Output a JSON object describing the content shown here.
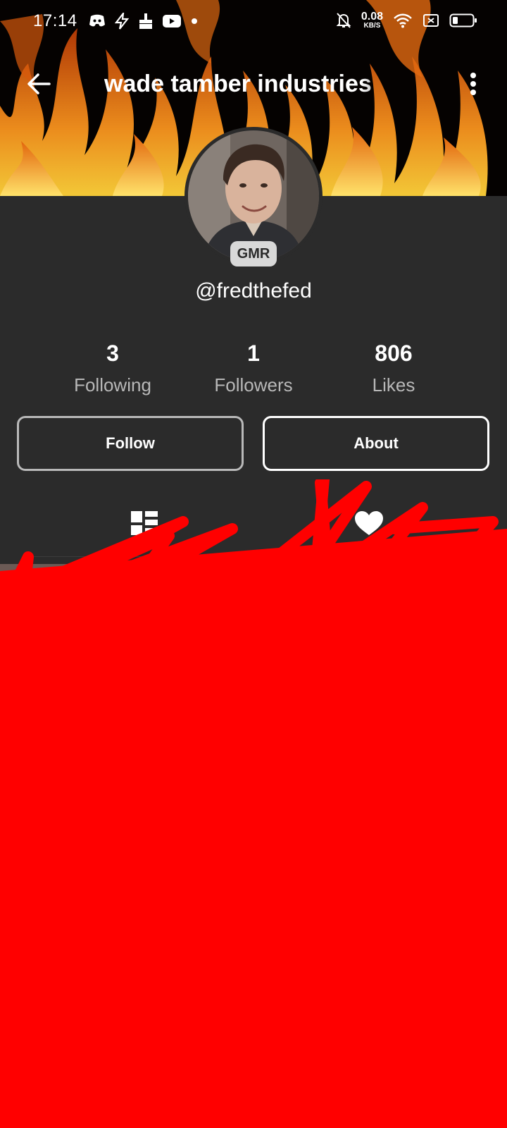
{
  "status_bar": {
    "time": "17:14",
    "net_speed_value": "0.08",
    "net_speed_unit": "KB/S",
    "left_icons": [
      "discord-icon",
      "bolt-icon",
      "brush-icon",
      "youtube-icon",
      "dot-icon"
    ],
    "right_icons": [
      "mute-icon",
      "wifi-icon",
      "sim-off-icon",
      "battery-icon"
    ]
  },
  "header": {
    "title": "wade tamber industries",
    "back_icon": "arrow-left-icon",
    "more_icon": "more-vertical-icon"
  },
  "profile": {
    "badge": "GMR",
    "username": "@fredthefed"
  },
  "stats": [
    {
      "value": "3",
      "label": "Following"
    },
    {
      "value": "1",
      "label": "Followers"
    },
    {
      "value": "806",
      "label": "Likes"
    }
  ],
  "actions": {
    "follow_label": "Follow",
    "about_label": "About"
  },
  "tabs": [
    {
      "icon": "grid-icon",
      "selected": true
    },
    {
      "icon": "heart-icon",
      "selected": false
    }
  ],
  "colors": {
    "background": "#2b2b2b",
    "scribble": "#ff0000",
    "fire_orange": "#f7931e"
  }
}
